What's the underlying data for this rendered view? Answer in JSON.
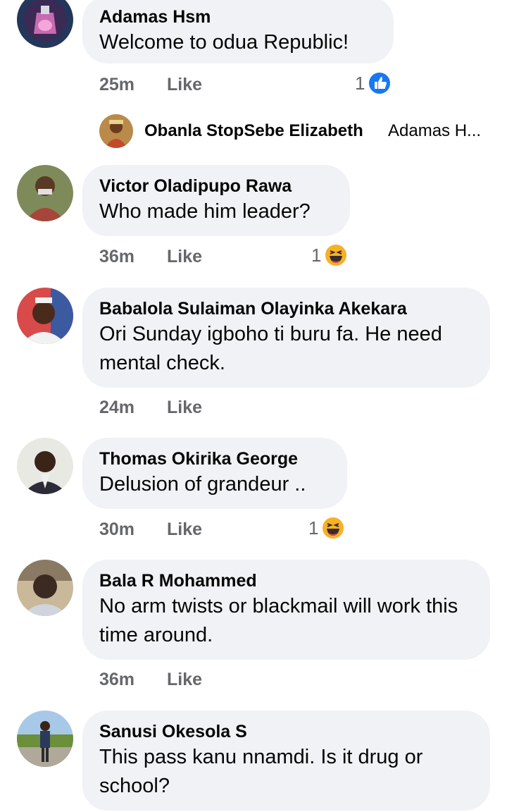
{
  "comments": [
    {
      "name": "Adamas Hsm",
      "text": "Welcome to odua Republic!",
      "time": "25m",
      "like": "Like",
      "reaction_count": "1",
      "reaction_icon": "like-icon"
    },
    {
      "name": "Victor Oladipupo Rawa",
      "text": "Who made him leader?",
      "time": "36m",
      "like": "Like",
      "reaction_count": "1",
      "reaction_icon": "haha-icon"
    },
    {
      "name": "Babalola Sulaiman Olayinka Akekara",
      "text": "Ori Sunday igboho ti buru fa. He need mental check.",
      "time": "24m",
      "like": "Like"
    },
    {
      "name": "Thomas Okirika George",
      "text": "Delusion of grandeur ..",
      "time": "30m",
      "like": "Like",
      "reaction_count": "1",
      "reaction_icon": "haha-icon"
    },
    {
      "name": "Bala R Mohammed",
      "text": "No arm twists or blackmail will  work this time around.",
      "time": "36m",
      "like": "Like"
    },
    {
      "name": "Sanusi Okesola S",
      "text": "This pass kanu nnamdi. Is it drug or school?"
    }
  ],
  "reply_preview": {
    "name": "Obanla StopSebe Elizabeth",
    "text": "Adamas H..."
  },
  "colors": {
    "bubble": "#f0f2f5",
    "meta": "#65676b",
    "text": "#050505",
    "like_blue": "#1877f2",
    "haha_yellow": "#f7b125"
  }
}
